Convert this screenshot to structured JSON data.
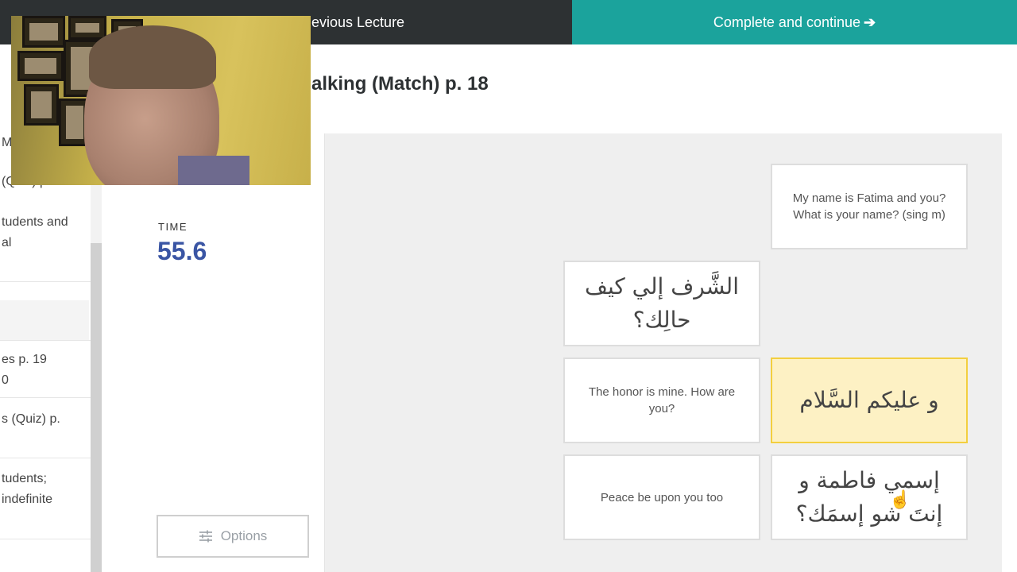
{
  "topbar": {
    "prev_lecture": "evious Lecture",
    "complete_label": "Complete and continue",
    "complete_arrow": "➔"
  },
  "lecture": {
    "title": "alking (Match) p. 18"
  },
  "sidebar": {
    "items": [
      "M",
      "(Quiz) p. 19",
      "tudents and",
      "al",
      "es p. 19",
      "0",
      "s (Quiz) p.",
      "tudents;",
      " indefinite"
    ]
  },
  "game": {
    "time_label": "TIME",
    "time_value": "55.6",
    "options_label": "Options"
  },
  "tiles": [
    {
      "text": "My name is Fatima and you? What is your name? (sing m)",
      "lang": "en",
      "selected": false
    },
    {
      "text": "الشَّرف إلي كيف حالِك؟",
      "lang": "ar",
      "selected": false
    },
    {
      "text": "The honor is mine. How are you?",
      "lang": "en",
      "selected": false
    },
    {
      "text": "و عليكم السَّلام",
      "lang": "ar",
      "selected": true
    },
    {
      "text": "Peace be upon you too",
      "lang": "en",
      "selected": false
    },
    {
      "text": "إسمي فاطمة و إنتَ شو إسمَك؟",
      "lang": "ar",
      "selected": false
    }
  ],
  "colors": {
    "accent": "#1ba39c",
    "dark_bar": "#2d3133",
    "time_value": "#3a55a4",
    "selected_tile": "#fdf1c4"
  }
}
